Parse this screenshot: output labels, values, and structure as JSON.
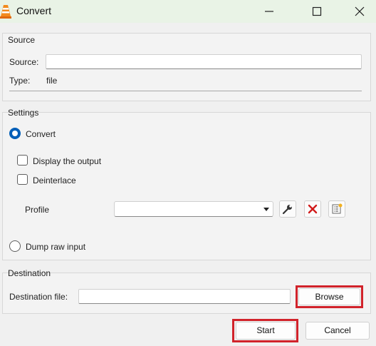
{
  "window": {
    "title": "Convert"
  },
  "source": {
    "group_title": "Source",
    "source_label": "Source:",
    "source_value": "",
    "type_label": "Type:",
    "type_value": "file"
  },
  "settings": {
    "group_title": "Settings",
    "convert_label": "Convert",
    "convert_selected": true,
    "display_output_label": "Display the output",
    "display_output_checked": false,
    "deinterlace_label": "Deinterlace",
    "deinterlace_checked": false,
    "profile_label": "Profile",
    "profile_value": "",
    "dump_raw_label": "Dump raw input",
    "dump_raw_selected": false
  },
  "destination": {
    "group_title": "Destination",
    "file_label": "Destination file:",
    "file_value": "",
    "browse_label": "Browse"
  },
  "actions": {
    "start_label": "Start",
    "cancel_label": "Cancel"
  },
  "colors": {
    "highlight": "#d1232b",
    "radio_selected": "#005fb8",
    "titlebar": "#e9f3e6"
  },
  "icons": [
    "vlc-cone-icon",
    "minimize-icon",
    "maximize-icon",
    "close-icon",
    "wrench-icon",
    "delete-icon",
    "new-profile-icon"
  ]
}
